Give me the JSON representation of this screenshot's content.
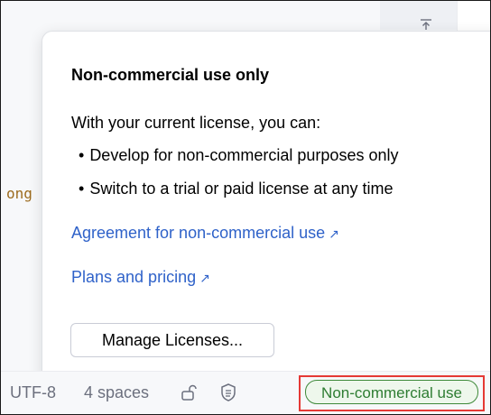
{
  "editor": {
    "code_fragment": "ong"
  },
  "popup": {
    "title": "Non-commercial use only",
    "intro": "With your current license, you can:",
    "bullets": [
      "Develop for non-commercial purposes only",
      "Switch to a trial or paid license at any time"
    ],
    "bullet_glyph": "•",
    "links": [
      {
        "label": "Agreement for non-commercial use",
        "icon": "external-arrow-icon",
        "glyph": "↗"
      },
      {
        "label": "Plans and pricing",
        "icon": "external-arrow-icon",
        "glyph": "↗"
      }
    ],
    "manage_button": "Manage Licenses..."
  },
  "status_bar": {
    "encoding": "UTF-8",
    "indent": "4 spaces",
    "lock_icon": "unlock-icon",
    "inspection_icon": "shield-icon",
    "license_badge": "Non-commercial use"
  },
  "colors": {
    "link": "#2f62c9",
    "badge_text": "#2e7d32",
    "badge_border": "#3f8a3a",
    "highlight": "#e53935"
  }
}
